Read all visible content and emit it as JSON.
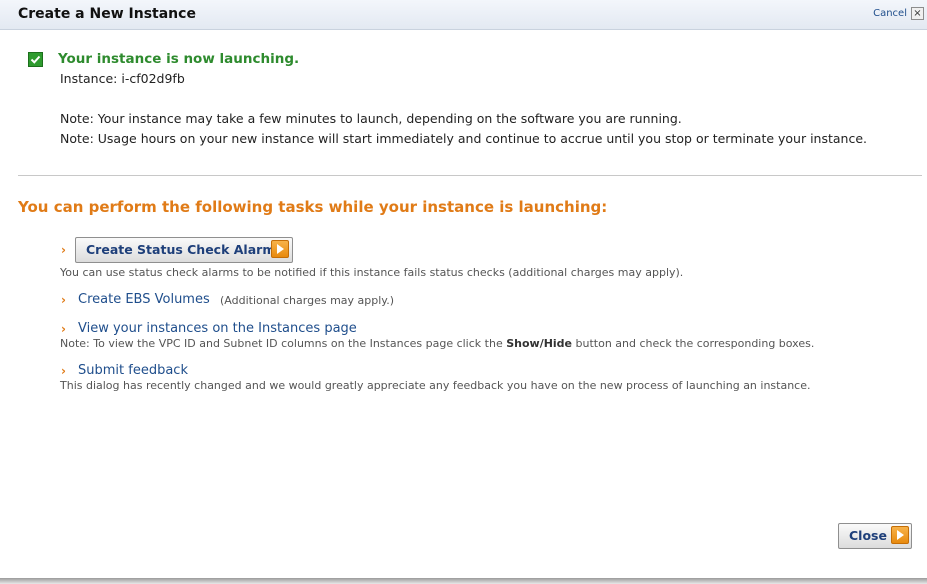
{
  "dialog": {
    "title": "Create a New Instance",
    "cancel_label": "Cancel",
    "close_x": "×"
  },
  "status": {
    "title": "Your instance is now launching.",
    "instance_label": "Instance:",
    "instance_id": "i-cf02d9fb",
    "note1": "Note: Your instance may take a few minutes to launch, depending on the software you are running.",
    "note2": "Note: Usage hours on your new instance will start immediately and continue to accrue until you stop or terminate your instance."
  },
  "tasks": {
    "heading": "You can perform the following tasks while your instance is launching:",
    "bullet": "›",
    "alarm_button": "Create Status Check Alarm",
    "alarm_desc": "You can use status check alarms to be notified if this instance fails status checks (additional charges may apply).",
    "ebs_link": "Create EBS Volumes",
    "ebs_suffix": "(Additional charges may apply.)",
    "instances_link": "View your instances on the Instances page",
    "instances_desc_pre": "Note: To view the VPC ID and Subnet ID columns on the Instances page click the",
    "instances_desc_bold": "Show/Hide",
    "instances_desc_post": "button and check the corresponding boxes.",
    "feedback_link": "Submit feedback",
    "feedback_desc": "This dialog has recently changed and we would greatly appreciate any feedback you have on the new process of launching an instance."
  },
  "footer": {
    "close_button": "Close"
  },
  "colors": {
    "success": "#2e8b2e",
    "heading": "#e07b17",
    "link": "#1f4e8c"
  }
}
